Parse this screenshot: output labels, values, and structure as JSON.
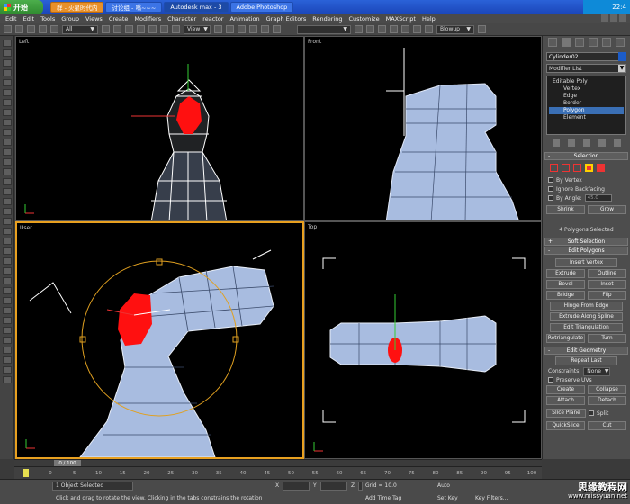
{
  "taskbar": {
    "start_label": "开始",
    "tasks": [
      {
        "label": "群 - 火星时代内",
        "active": false,
        "style": "orange"
      },
      {
        "label": "讨论组 - 嗡~~~",
        "active": false,
        "style": "normal"
      },
      {
        "label": "Autodesk max - 3",
        "active": true,
        "style": "normal"
      },
      {
        "label": "Adobe Photoshop",
        "active": false,
        "style": "normal"
      }
    ],
    "clock": "22:4"
  },
  "menubar": {
    "items": [
      "Edit",
      "Edit",
      "Tools",
      "Group",
      "Views",
      "Create",
      "Modifiers",
      "Character",
      "reactor",
      "Animation",
      "Graph Editors",
      "Rendering",
      "Customize",
      "MAXScript",
      "Help"
    ]
  },
  "toolbar": {
    "selection_filter": "All",
    "reference_coord": "View",
    "named_selection": "",
    "render_preset": "Blowup"
  },
  "viewports": {
    "left": {
      "label": "Left"
    },
    "front": {
      "label": "Front"
    },
    "user": {
      "label": "User"
    },
    "top": {
      "label": "Top"
    }
  },
  "panel": {
    "object_name": "Cylinder02",
    "object_color": "#1c5cc8",
    "modifier_list_label": "Modifier List",
    "stack": [
      {
        "label": "Editable Poly",
        "root": true,
        "selected": false
      },
      {
        "label": "Vertex",
        "root": false,
        "selected": false
      },
      {
        "label": "Edge",
        "root": false,
        "selected": false
      },
      {
        "label": "Border",
        "root": false,
        "selected": false
      },
      {
        "label": "Polygon",
        "root": false,
        "selected": true
      },
      {
        "label": "Element",
        "root": false,
        "selected": false
      }
    ],
    "selection": {
      "title": "Selection",
      "by_vertex": "By Vertex",
      "ignore_backfacing": "Ignore Backfacing",
      "by_angle": "By Angle:",
      "by_angle_value": "45.0",
      "shrink": "Shrink",
      "grow": "Grow",
      "status": "4 Polygons Selected"
    },
    "soft_selection": {
      "title": "Soft Selection"
    },
    "edit_polygons": {
      "title": "Edit Polygons",
      "insert_vertex": "Insert Vertex",
      "extrude": "Extrude",
      "outline": "Outline",
      "bevel": "Bevel",
      "inset": "Inset",
      "bridge": "Bridge",
      "flip": "Flip",
      "hinge_from_edge": "Hinge From Edge",
      "extrude_along_spline": "Extrude Along Spline",
      "edit_triangulation": "Edit Triangulation",
      "retriangulate": "Retriangulate",
      "turn": "Turn"
    },
    "edit_geometry": {
      "title": "Edit Geometry",
      "repeat_last": "Repeat Last",
      "constraints_label": "Constraints:",
      "constraints_value": "None",
      "preserve_uvs": "Preserve UVs",
      "create": "Create",
      "collapse": "Collapse",
      "attach": "Attach",
      "detach": "Detach",
      "slice_plane": "Slice Plane",
      "split": "Split",
      "quickslice": "QuickSlice",
      "cut": "Cut"
    }
  },
  "timeline": {
    "slider_label": "0 / 100",
    "ticks": [
      "0",
      "5",
      "10",
      "15",
      "20",
      "25",
      "30",
      "35",
      "40",
      "45",
      "50",
      "55",
      "60",
      "65",
      "70",
      "75",
      "80",
      "85",
      "90",
      "95",
      "100"
    ]
  },
  "status": {
    "selection_count": "1 Object Selected",
    "prompt": "Click and drag to rotate the view.  Clicking in the tabs constrains the rotation",
    "x_label": "X",
    "y_label": "Y",
    "z_label": "Z",
    "grid": "Grid = 10.0",
    "add_time_tag": "Add Time Tag",
    "auto_key": "Auto",
    "set_key": "Set Key",
    "key_filters": "Key Filters..."
  },
  "watermark": {
    "title": "思缘教程网",
    "url": "www.missyuan.net"
  }
}
